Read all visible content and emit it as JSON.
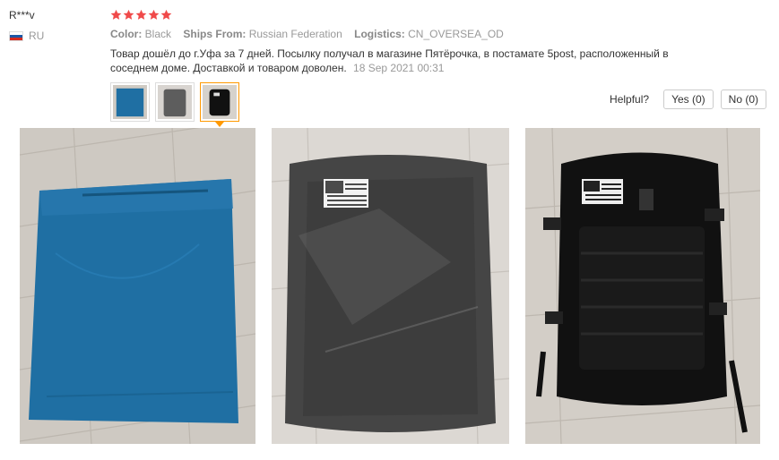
{
  "reviewer": {
    "name": "R***v",
    "country_code": "RU",
    "flag_colors": [
      "#ffffff",
      "#1c57a5",
      "#d52b1e"
    ]
  },
  "rating": {
    "stars": 5,
    "max": 5,
    "color": "#f04a4a"
  },
  "details": {
    "color_label": "Color:",
    "color_value": "Black",
    "ships_label": "Ships From:",
    "ships_value": "Russian Federation",
    "logistics_label": "Logistics:",
    "logistics_value": "CN_OVERSEA_OD"
  },
  "review": {
    "text": "Товар дошёл до г.Уфа за 7 дней. Посылку получал в магазине Пятёрочка, в постамате 5post, расположенный в соседнем доме. Доставкой и товаром доволен.",
    "date": "18 Sep 2021 00:31"
  },
  "thumbnails": [
    {
      "name": "blue-package",
      "active": false
    },
    {
      "name": "wrapped-backpack",
      "active": false
    },
    {
      "name": "black-backpack",
      "active": true
    }
  ],
  "helpful": {
    "label": "Helpful?",
    "yes_label": "Yes (0)",
    "no_label": "No (0)"
  },
  "photos": [
    {
      "name": "blue-package-photo"
    },
    {
      "name": "wrapped-backpack-photo"
    },
    {
      "name": "black-backpack-photo"
    }
  ],
  "colors": {
    "accent": "#ff9900",
    "package_blue": "#1f6fa3",
    "floor": "#c9c3bb"
  }
}
